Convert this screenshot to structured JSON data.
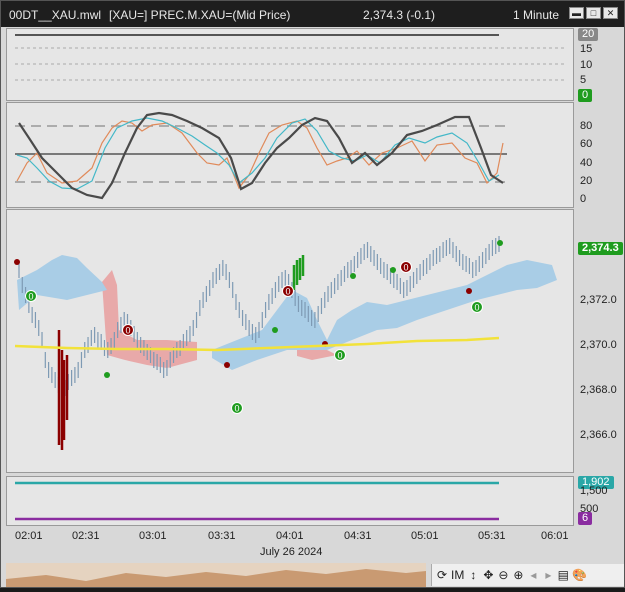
{
  "window": {
    "file": "00DT__XAU.mwl",
    "symbol": "[XAU=] PREC.M.XAU=(Mid Price)",
    "last": "2,374.3 (-0.1)",
    "interval": "1 Minute",
    "buttons": [
      "▬",
      "□",
      "✕"
    ]
  },
  "panel1": {
    "ticks": [
      "20",
      "15",
      "10",
      "5",
      "0"
    ],
    "value_tag": "20",
    "zero_tag": "0"
  },
  "panel2": {
    "ticks": [
      "80",
      "60",
      "40",
      "20",
      "0"
    ]
  },
  "panel3": {
    "ticks": [
      "2,372.0",
      "2,370.0",
      "2,368.0",
      "2,366.0"
    ],
    "price_tag": "2,374.3",
    "signal_label": "0"
  },
  "panel4": {
    "ticks": [
      "1,500",
      "500"
    ],
    "tag_top": "1,902",
    "tag_bottom": "6"
  },
  "time_axis": {
    "labels": [
      "02:01",
      "02:31",
      "03:01",
      "03:31",
      "04:01",
      "04:31",
      "05:01",
      "05:31",
      "06:01"
    ],
    "date": "July 26 2024"
  },
  "toolbar": {
    "items": [
      "⟳",
      "IM",
      "↕",
      "✥",
      "⊖",
      "⊕",
      "◂",
      "▸",
      "▤",
      "🎨"
    ]
  },
  "colors": {
    "up": "#1f9c1f",
    "down": "#8b0000",
    "cloud_bull": "#a9cde6",
    "cloud_bear": "#e8a9a9",
    "ma": "#f2e23a",
    "teal": "#2aa7a7",
    "purple": "#8a2ca0"
  }
}
